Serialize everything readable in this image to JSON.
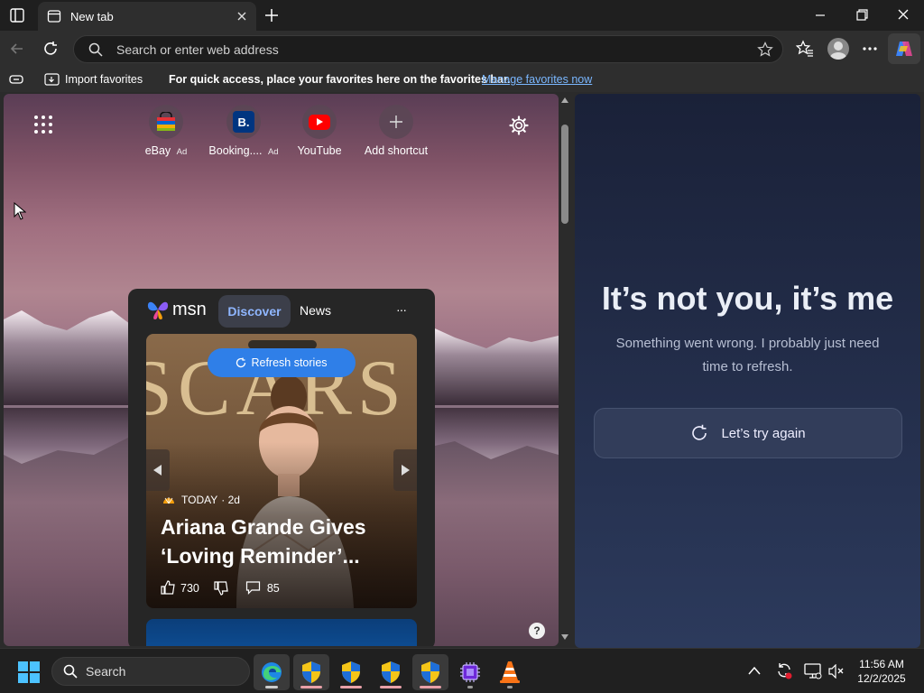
{
  "tab": {
    "title": "New tab"
  },
  "address": {
    "placeholder": "Search or enter web address"
  },
  "favbar": {
    "import_label": "Import favorites",
    "hint": "For quick access, place your favorites here on the favorites bar.",
    "manage_link": "Manage favorites now"
  },
  "shortcuts": [
    {
      "label": "eBay",
      "ad": "Ad"
    },
    {
      "label": "Booking....",
      "ad": "Ad"
    },
    {
      "label": "YouTube",
      "ad": ""
    },
    {
      "label": "Add shortcut",
      "ad": ""
    }
  ],
  "msn": {
    "logo_text": "msn",
    "tabs": [
      "Discover",
      "News"
    ],
    "more": "···",
    "refresh_label": "Refresh stories",
    "card": {
      "bg_text": "SCARS",
      "source": "TODAY",
      "age": "· 2d",
      "headline_line1": "Ariana Grande Gives",
      "headline_line2": "‘Loving Reminder’...",
      "likes": "730",
      "comments": "85"
    }
  },
  "help": {
    "label": "?"
  },
  "sidepanel": {
    "title": "It’s not you, it’s me",
    "message_line1": "Something went wrong. I probably just need",
    "message_line2": "time to refresh.",
    "retry_label": "Let’s try again"
  },
  "taskbar": {
    "search_label": "Search",
    "time": "11:56 AM",
    "date": "12/2/2025"
  },
  "colors": {
    "accent": "#2f7fe8",
    "link": "#7ab7ff",
    "taskbar_indicator": "#e8a0a8"
  }
}
